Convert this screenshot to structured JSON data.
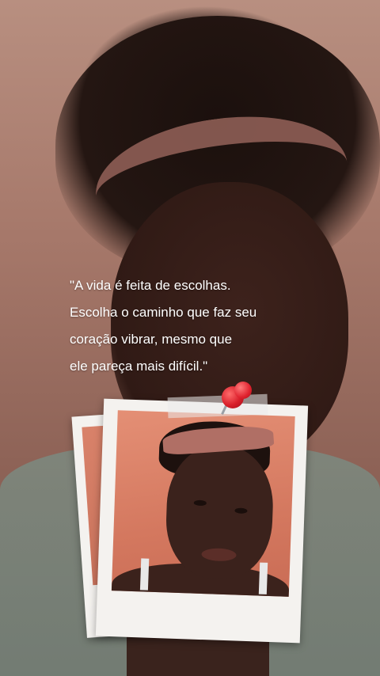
{
  "story": {
    "quote_lines": [
      "\"A vida é feita de escolhas.",
      "Escolha o caminho que faz seu",
      "coração vibrar, mesmo que",
      "ele pareça mais difícil.\""
    ],
    "colors": {
      "quote_text": "#ffffff",
      "polaroid_frame": "#f4f2ef",
      "pin": "#d81f2a"
    }
  }
}
